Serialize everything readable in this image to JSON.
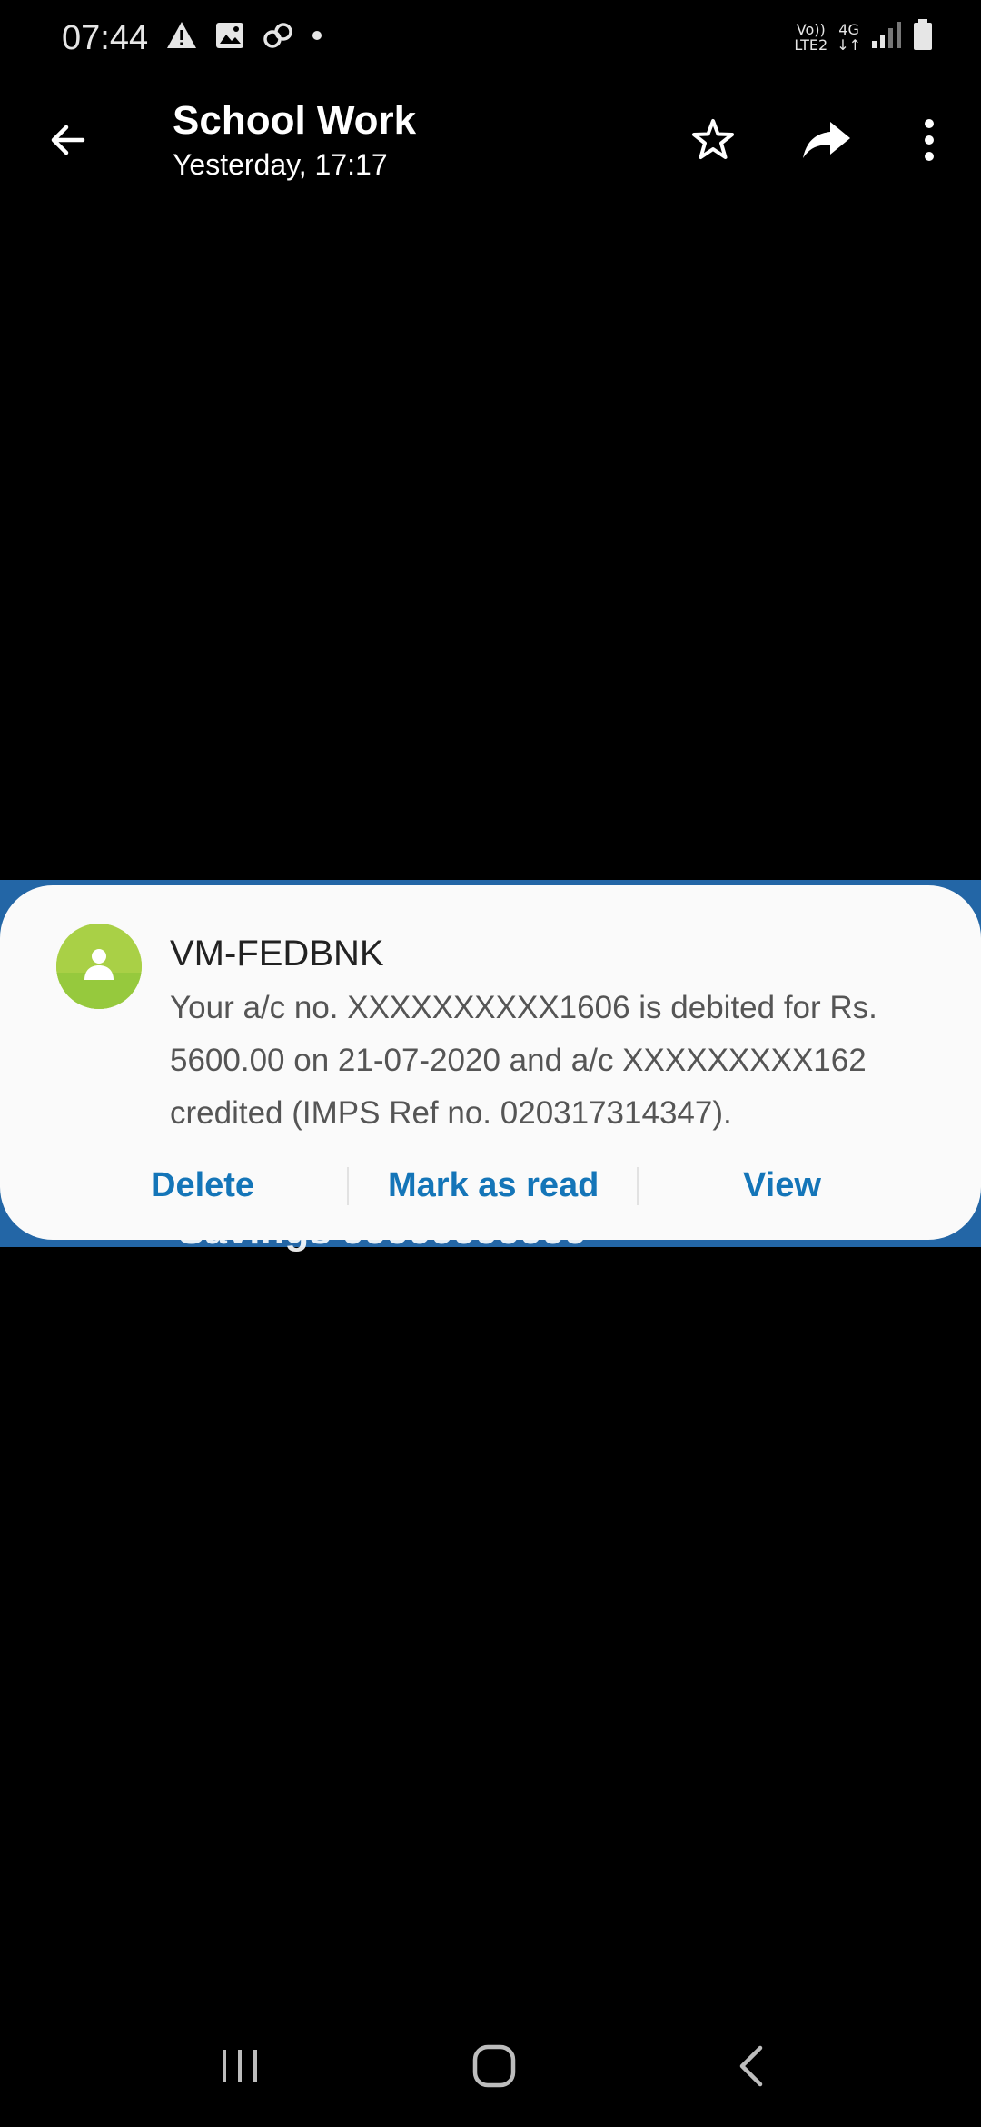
{
  "status_bar": {
    "time": "07:44",
    "left_icons": [
      "warning-icon",
      "image-icon",
      "link-icon",
      "dot-icon"
    ],
    "network_top": "Vo))",
    "network_bottom": "LTE2",
    "data_label": "4G",
    "right_icons": [
      "signal-icon",
      "battery-icon"
    ]
  },
  "app_bar": {
    "title": "School Work",
    "subtitle": "Yesterday, 17:17",
    "icons": [
      "back-arrow-icon",
      "star-icon",
      "forward-icon",
      "more-vert-icon"
    ]
  },
  "background": {
    "partial_text": "Savings 99999999999"
  },
  "notification": {
    "sender": "VM-FEDBNK",
    "message": "Your a/c no. XXXXXXXXXX1606 is debited for Rs. 5600.00 on 21-07-2020 and a/c XXXXXXXXX162 credited (IMPS Ref no. 020317314347).",
    "actions": {
      "delete": "Delete",
      "mark_read": "Mark as read",
      "view": "View"
    },
    "avatar_icon": "person-icon",
    "accent_color": "#1475b8",
    "avatar_color": "#a9d046"
  },
  "nav_bar": {
    "icons": [
      "recents-icon",
      "home-icon",
      "nav-back-icon"
    ]
  },
  "colors": {
    "background": "#000000",
    "strip": "#2366a6",
    "card": "#fafafa"
  }
}
